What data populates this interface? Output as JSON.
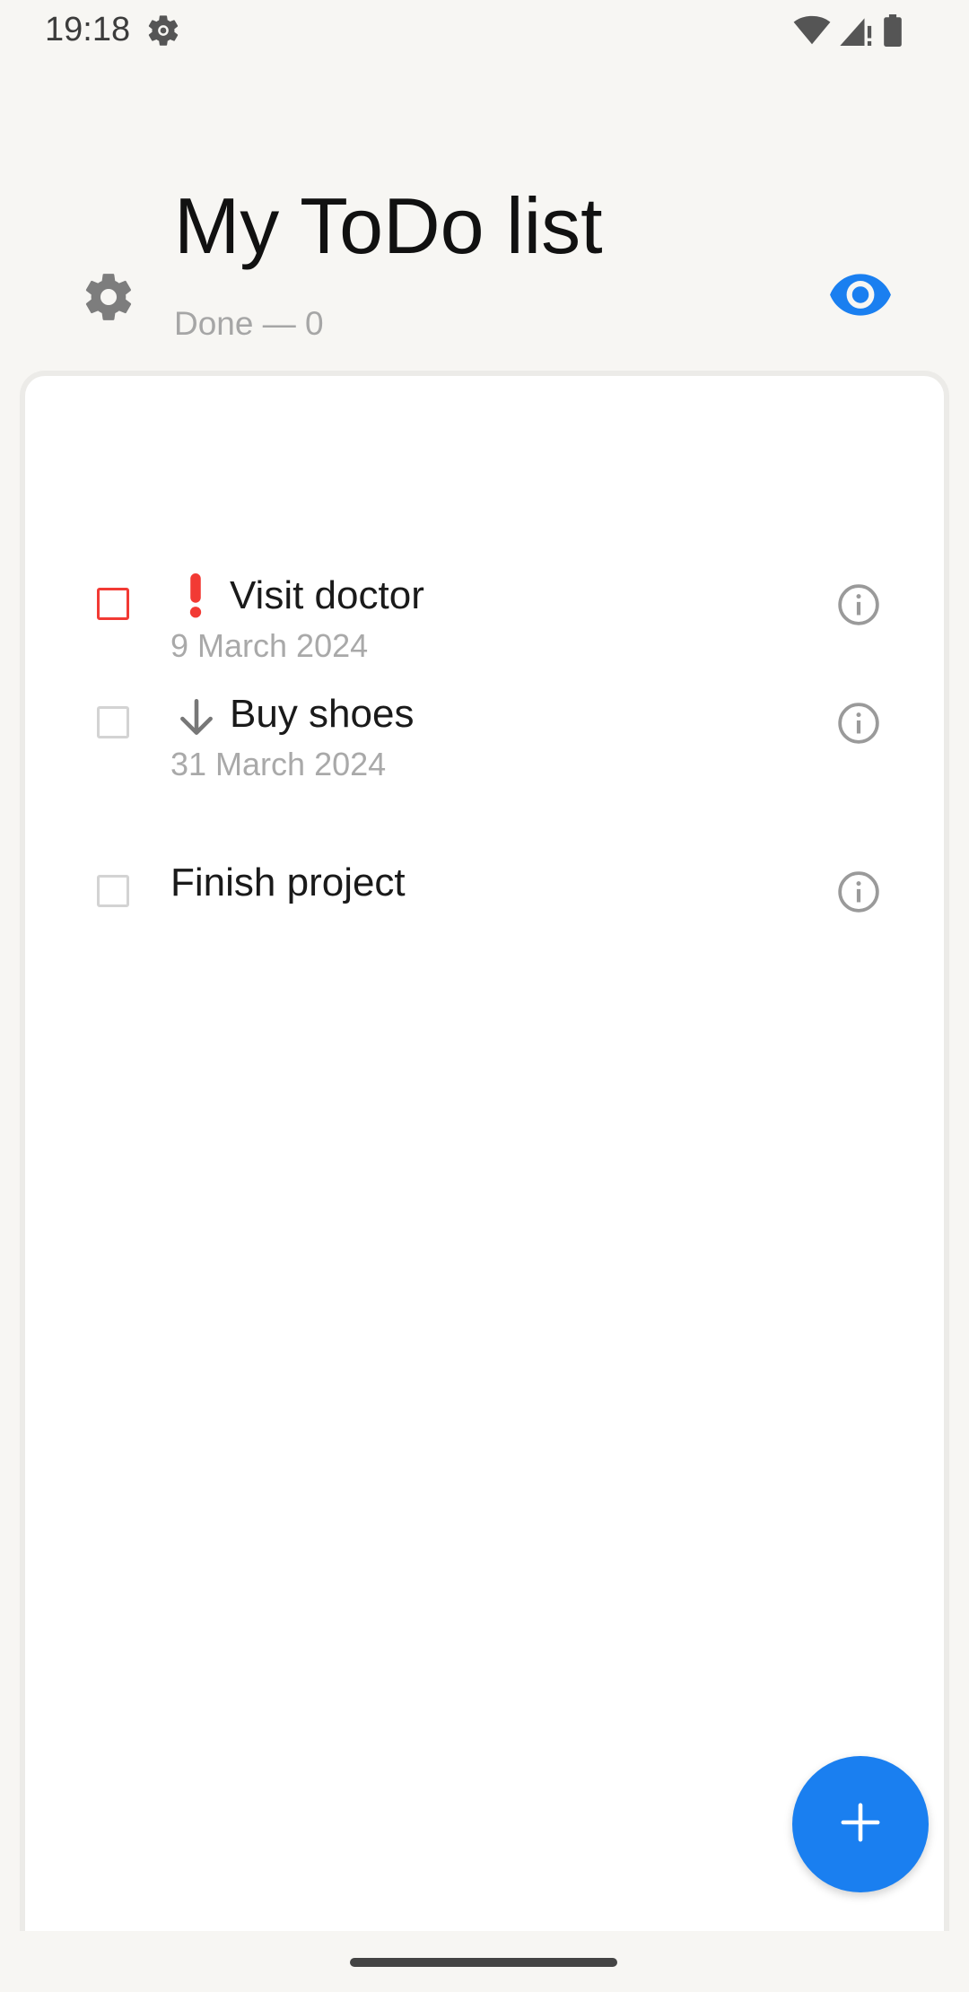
{
  "status_bar": {
    "time": "19:18",
    "icons": [
      "settings-gear-icon",
      "wifi-icon",
      "cell-signal-icon",
      "battery-icon"
    ]
  },
  "header": {
    "title": "My ToDo list",
    "subtitle": "Done — 0",
    "settings_icon": "gear-icon",
    "visibility_icon": "eye-icon",
    "accent_color": "#1a7ff0"
  },
  "tasks": [
    {
      "title": "Visit doctor",
      "date": "9 March 2024",
      "priority": "high",
      "priority_icon": "exclamation-icon",
      "checked": false
    },
    {
      "title": "Buy shoes",
      "date": "31 March 2024",
      "priority": "low",
      "priority_icon": "arrow-down-icon",
      "checked": false
    },
    {
      "title": "Finish project",
      "date": "",
      "priority": "normal",
      "priority_icon": "",
      "checked": false
    }
  ],
  "fab": {
    "icon": "plus-icon",
    "color": "#1a7ff0"
  },
  "colors": {
    "urgent": "#f23a34",
    "background": "#f7f6f3",
    "card": "#ffffff"
  }
}
